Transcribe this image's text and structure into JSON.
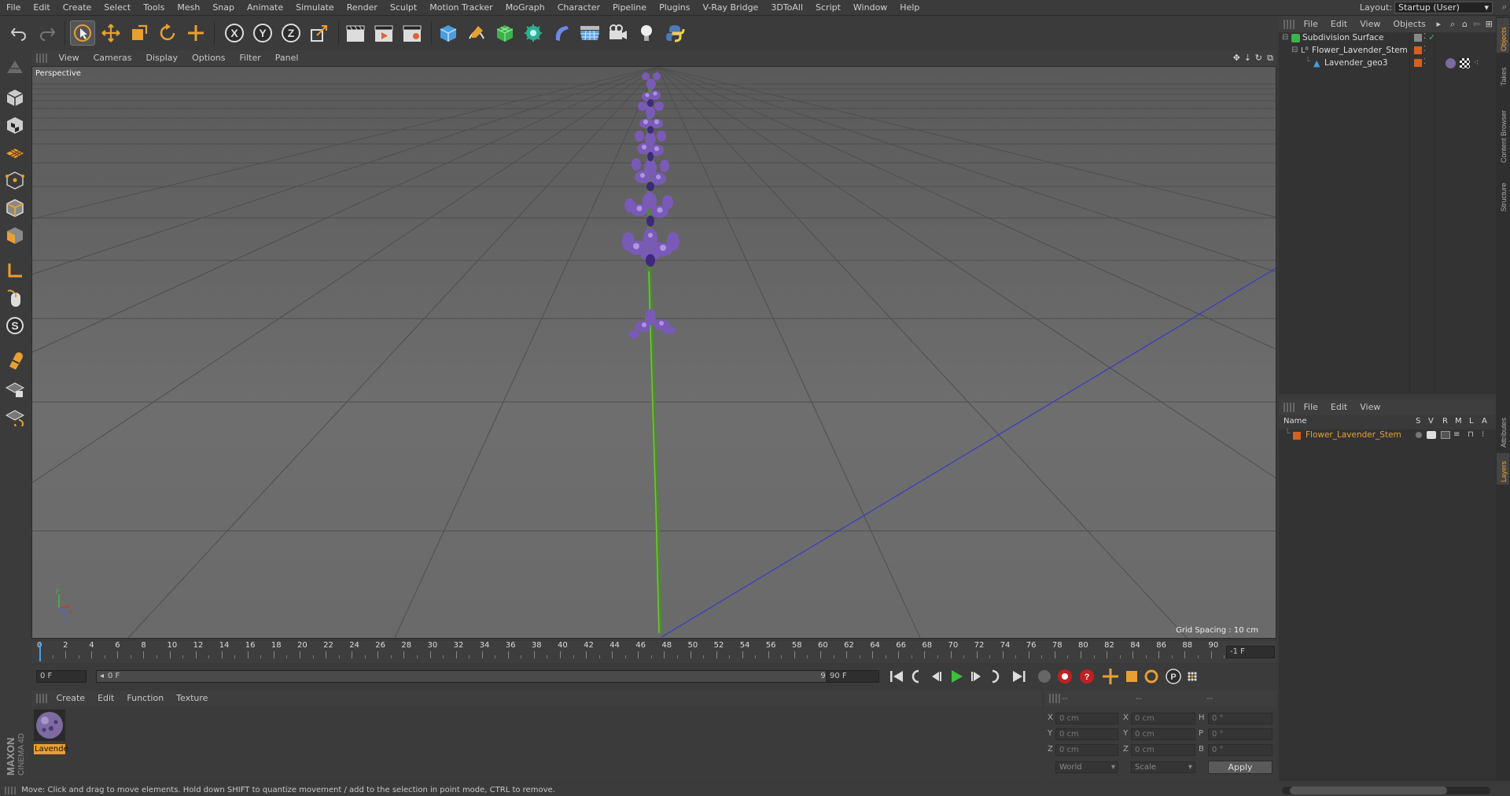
{
  "menu": [
    "File",
    "Edit",
    "Create",
    "Select",
    "Tools",
    "Mesh",
    "Snap",
    "Animate",
    "Simulate",
    "Render",
    "Sculpt",
    "Motion Tracker",
    "MoGraph",
    "Character",
    "Pipeline",
    "Plugins",
    "V-Ray Bridge",
    "3DToAll",
    "Script",
    "Window",
    "Help"
  ],
  "layout": {
    "label": "Layout:",
    "value": "Startup (User)"
  },
  "viewport": {
    "menu": [
      "View",
      "Cameras",
      "Display",
      "Options",
      "Filter",
      "Panel"
    ],
    "camera_label": "Perspective",
    "grid_spacing": "Grid Spacing : 10 cm"
  },
  "timeline": {
    "ticks": [
      "0",
      "2",
      "4",
      "6",
      "8",
      "10",
      "12",
      "14",
      "16",
      "18",
      "20",
      "22",
      "24",
      "26",
      "28",
      "30",
      "32",
      "34",
      "36",
      "38",
      "40",
      "42",
      "44",
      "46",
      "48",
      "50",
      "52",
      "54",
      "56",
      "58",
      "60",
      "62",
      "64",
      "66",
      "68",
      "70",
      "72",
      "74",
      "76",
      "78",
      "80",
      "82",
      "84",
      "86",
      "88",
      "90"
    ],
    "current_frame": "-1 F"
  },
  "transport": {
    "start_field": "0 F",
    "range_start": "0 F",
    "range_end": "90 F",
    "end_field": "90 F"
  },
  "material_panel": {
    "menu": [
      "Create",
      "Edit",
      "Function",
      "Texture"
    ],
    "material_name": "Lavende"
  },
  "coords": {
    "headers": [
      "--",
      "--",
      "--"
    ],
    "rows": [
      {
        "a": "X",
        "av": "0 cm",
        "b": "X",
        "bv": "0 cm",
        "c": "H",
        "cv": "0 °"
      },
      {
        "a": "Y",
        "av": "0 cm",
        "b": "Y",
        "bv": "0 cm",
        "c": "P",
        "cv": "0 °"
      },
      {
        "a": "Z",
        "av": "0 cm",
        "b": "Z",
        "bv": "0 cm",
        "c": "B",
        "cv": "0 °"
      }
    ],
    "space": "World",
    "mode": "Scale",
    "apply": "Apply"
  },
  "objects_panel": {
    "menu": [
      "File",
      "Edit",
      "View",
      "Objects"
    ],
    "items": [
      {
        "name": "Subdivision Surface",
        "indent": 0
      },
      {
        "name": "Flower_Lavender_Stem",
        "indent": 1
      },
      {
        "name": "Lavender_geo3",
        "indent": 2
      }
    ]
  },
  "layers_panel": {
    "menu": [
      "File",
      "Edit",
      "View"
    ],
    "columns": [
      "Name",
      "S",
      "V",
      "R",
      "M",
      "L",
      "A"
    ],
    "layer_name": "Flower_Lavender_Stem"
  },
  "side_tabs": [
    "Objects",
    "Takes",
    "Content Browser",
    "Structure",
    "Attributes",
    "Layers"
  ],
  "status": "Move: Click and drag to move elements. Hold down SHIFT to quantize movement / add to the selection in point mode, CTRL to remove.",
  "brand": {
    "maxon": "MAXON",
    "product": "CINEMA 4D"
  },
  "colors": {
    "accent": "#e8a030",
    "layer_orange": "#d6601c",
    "axis_blue": "#3a3ac8",
    "play_green": "#3ec03e"
  }
}
